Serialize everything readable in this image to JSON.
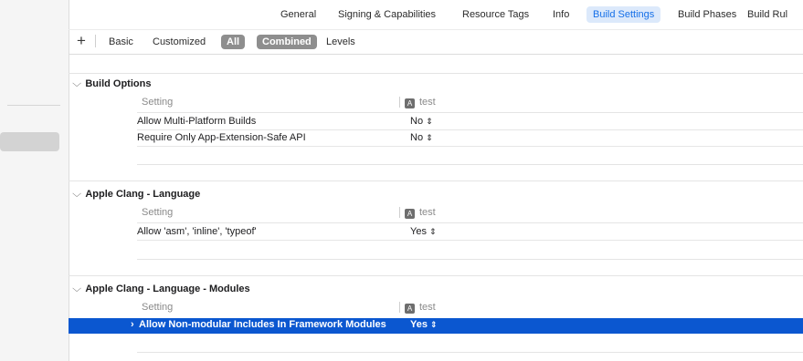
{
  "tabs": [
    "General",
    "Signing & Capabilities",
    "Resource Tags",
    "Info",
    "Build Settings",
    "Build Phases",
    "Build Rul"
  ],
  "active_tab": "Build Settings",
  "filter": {
    "add_label": "+",
    "basic": "Basic",
    "customized": "Customized",
    "all": "All",
    "combined": "Combined",
    "levels": "Levels"
  },
  "sections": [
    {
      "title": "Build Options",
      "column_setting": "Setting",
      "column_target": "test",
      "rows": [
        {
          "name": "Allow Multi-Platform Builds",
          "value": "No"
        },
        {
          "name": "Require Only App-Extension-Safe API",
          "value": "No"
        }
      ]
    },
    {
      "title": "Apple Clang - Language",
      "column_setting": "Setting",
      "column_target": "test",
      "rows": [
        {
          "name": "Allow 'asm', 'inline', 'typeof'",
          "value": "Yes"
        }
      ]
    },
    {
      "title": "Apple Clang - Language - Modules",
      "column_setting": "Setting",
      "column_target": "test",
      "rows": [
        {
          "name": "Allow Non-modular Includes In Framework Modules",
          "value": "Yes",
          "selected": true
        }
      ]
    }
  ],
  "icons": {
    "section_chevron": "chevron-down-icon",
    "target": "app-target-icon",
    "stepper": "up-down-stepper-icon",
    "disclosure": "chevron-right-icon"
  },
  "glyphs": {
    "chevron_down": "⌵",
    "chevron_right": "›",
    "stepper": "⇕",
    "target": "A"
  },
  "colors": {
    "selection": "#0b57d0",
    "active_tab_bg": "#dce9fb",
    "active_tab_text": "#1670e8"
  }
}
